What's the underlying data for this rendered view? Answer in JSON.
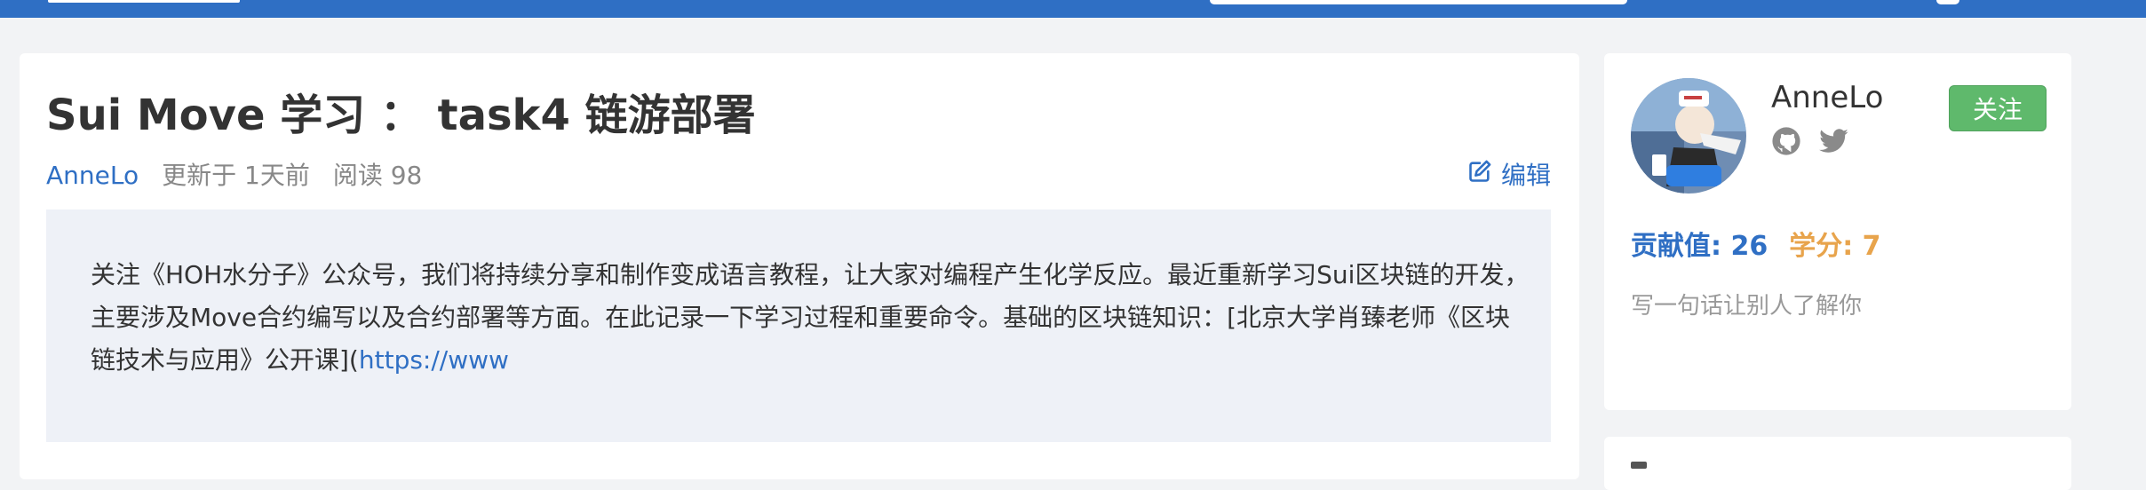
{
  "colors": {
    "brand_blue": "#2f6fc4",
    "page_bg": "#f2f3f5",
    "follow_green": "#5fb96c",
    "credit_orange": "#e8a44c"
  },
  "article": {
    "title": "Sui Move 学习 ： task4 链游部署",
    "author": "AnneLo",
    "updated": "更新于 1天前",
    "reads": "阅读 98",
    "edit_label": "编辑",
    "excerpt": "关注《HOH水分子》公众号，我们将持续分享和制作变成语言教程，让大家对编程产生化学反应。最近重新学习Sui区块链的开发，主要涉及Move合约编写以及合约部署等方面。在此记录一下学习过程和重要命令。基础的区块链知识：[北京大学肖臻老师《区块链技术与应用》公开课](",
    "excerpt_link": "https://www"
  },
  "profile": {
    "username": "AnneLo",
    "follow_label": "关注",
    "contribution": "贡献值: 26",
    "credits": "学分: 7",
    "bio": "写一句话让别人了解你",
    "social_icons": [
      "github-icon",
      "twitter-icon"
    ]
  }
}
